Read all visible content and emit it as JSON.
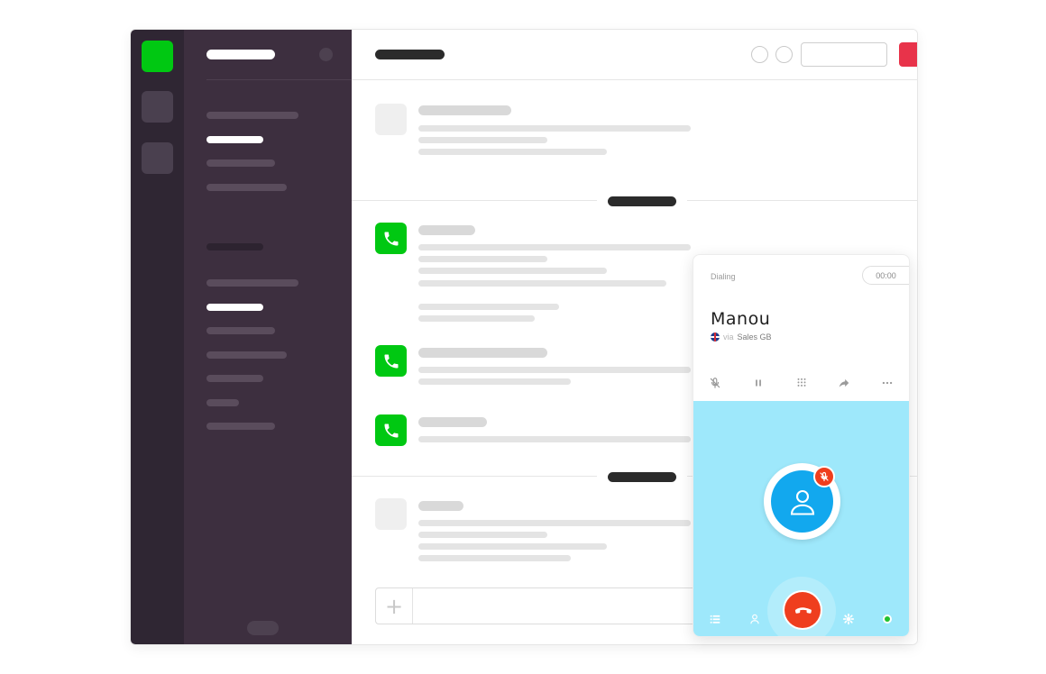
{
  "call": {
    "status": "Dialing",
    "timer": "00:00",
    "contact_name": "Manou",
    "via_prefix": "via",
    "via_line": "Sales GB",
    "controls": [
      "mute-icon",
      "pause-icon",
      "keypad-icon",
      "transfer-icon",
      "more-icon"
    ],
    "dock": [
      "list-icon",
      "contact-icon",
      "hangup-icon",
      "settings-icon",
      "presence-icon"
    ]
  },
  "colors": {
    "brand_green": "#00c812",
    "sidebar_dark": "#2f2633",
    "sidebar": "#3d2f3f",
    "call_stage": "#9ee8fb",
    "avatar": "#12a8ee",
    "hangup": "#ef3e1e",
    "alert_red": "#e8334a"
  },
  "composer": {
    "add_icon": "+"
  }
}
